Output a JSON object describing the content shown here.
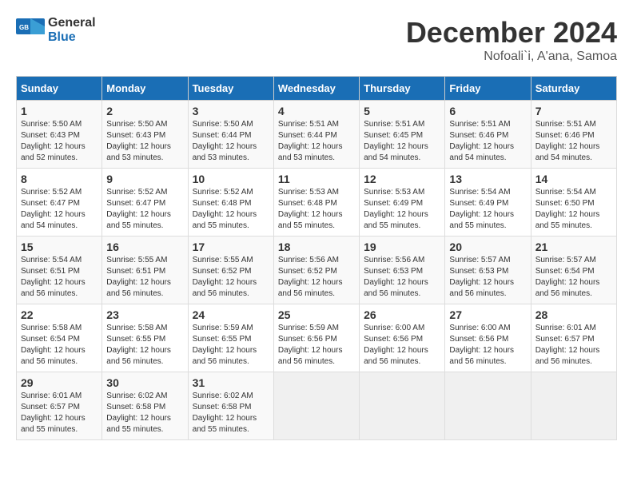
{
  "logo": {
    "general": "General",
    "blue": "Blue"
  },
  "title": "December 2024",
  "location": "Nofoali`i, A'ana, Samoa",
  "days_header": [
    "Sunday",
    "Monday",
    "Tuesday",
    "Wednesday",
    "Thursday",
    "Friday",
    "Saturday"
  ],
  "weeks": [
    [
      {
        "day": "1",
        "info": "Sunrise: 5:50 AM\nSunset: 6:43 PM\nDaylight: 12 hours\nand 52 minutes."
      },
      {
        "day": "2",
        "info": "Sunrise: 5:50 AM\nSunset: 6:43 PM\nDaylight: 12 hours\nand 53 minutes."
      },
      {
        "day": "3",
        "info": "Sunrise: 5:50 AM\nSunset: 6:44 PM\nDaylight: 12 hours\nand 53 minutes."
      },
      {
        "day": "4",
        "info": "Sunrise: 5:51 AM\nSunset: 6:44 PM\nDaylight: 12 hours\nand 53 minutes."
      },
      {
        "day": "5",
        "info": "Sunrise: 5:51 AM\nSunset: 6:45 PM\nDaylight: 12 hours\nand 54 minutes."
      },
      {
        "day": "6",
        "info": "Sunrise: 5:51 AM\nSunset: 6:46 PM\nDaylight: 12 hours\nand 54 minutes."
      },
      {
        "day": "7",
        "info": "Sunrise: 5:51 AM\nSunset: 6:46 PM\nDaylight: 12 hours\nand 54 minutes."
      }
    ],
    [
      {
        "day": "8",
        "info": "Sunrise: 5:52 AM\nSunset: 6:47 PM\nDaylight: 12 hours\nand 54 minutes."
      },
      {
        "day": "9",
        "info": "Sunrise: 5:52 AM\nSunset: 6:47 PM\nDaylight: 12 hours\nand 55 minutes."
      },
      {
        "day": "10",
        "info": "Sunrise: 5:52 AM\nSunset: 6:48 PM\nDaylight: 12 hours\nand 55 minutes."
      },
      {
        "day": "11",
        "info": "Sunrise: 5:53 AM\nSunset: 6:48 PM\nDaylight: 12 hours\nand 55 minutes."
      },
      {
        "day": "12",
        "info": "Sunrise: 5:53 AM\nSunset: 6:49 PM\nDaylight: 12 hours\nand 55 minutes."
      },
      {
        "day": "13",
        "info": "Sunrise: 5:54 AM\nSunset: 6:49 PM\nDaylight: 12 hours\nand 55 minutes."
      },
      {
        "day": "14",
        "info": "Sunrise: 5:54 AM\nSunset: 6:50 PM\nDaylight: 12 hours\nand 55 minutes."
      }
    ],
    [
      {
        "day": "15",
        "info": "Sunrise: 5:54 AM\nSunset: 6:51 PM\nDaylight: 12 hours\nand 56 minutes."
      },
      {
        "day": "16",
        "info": "Sunrise: 5:55 AM\nSunset: 6:51 PM\nDaylight: 12 hours\nand 56 minutes."
      },
      {
        "day": "17",
        "info": "Sunrise: 5:55 AM\nSunset: 6:52 PM\nDaylight: 12 hours\nand 56 minutes."
      },
      {
        "day": "18",
        "info": "Sunrise: 5:56 AM\nSunset: 6:52 PM\nDaylight: 12 hours\nand 56 minutes."
      },
      {
        "day": "19",
        "info": "Sunrise: 5:56 AM\nSunset: 6:53 PM\nDaylight: 12 hours\nand 56 minutes."
      },
      {
        "day": "20",
        "info": "Sunrise: 5:57 AM\nSunset: 6:53 PM\nDaylight: 12 hours\nand 56 minutes."
      },
      {
        "day": "21",
        "info": "Sunrise: 5:57 AM\nSunset: 6:54 PM\nDaylight: 12 hours\nand 56 minutes."
      }
    ],
    [
      {
        "day": "22",
        "info": "Sunrise: 5:58 AM\nSunset: 6:54 PM\nDaylight: 12 hours\nand 56 minutes."
      },
      {
        "day": "23",
        "info": "Sunrise: 5:58 AM\nSunset: 6:55 PM\nDaylight: 12 hours\nand 56 minutes."
      },
      {
        "day": "24",
        "info": "Sunrise: 5:59 AM\nSunset: 6:55 PM\nDaylight: 12 hours\nand 56 minutes."
      },
      {
        "day": "25",
        "info": "Sunrise: 5:59 AM\nSunset: 6:56 PM\nDaylight: 12 hours\nand 56 minutes."
      },
      {
        "day": "26",
        "info": "Sunrise: 6:00 AM\nSunset: 6:56 PM\nDaylight: 12 hours\nand 56 minutes."
      },
      {
        "day": "27",
        "info": "Sunrise: 6:00 AM\nSunset: 6:56 PM\nDaylight: 12 hours\nand 56 minutes."
      },
      {
        "day": "28",
        "info": "Sunrise: 6:01 AM\nSunset: 6:57 PM\nDaylight: 12 hours\nand 56 minutes."
      }
    ],
    [
      {
        "day": "29",
        "info": "Sunrise: 6:01 AM\nSunset: 6:57 PM\nDaylight: 12 hours\nand 55 minutes."
      },
      {
        "day": "30",
        "info": "Sunrise: 6:02 AM\nSunset: 6:58 PM\nDaylight: 12 hours\nand 55 minutes."
      },
      {
        "day": "31",
        "info": "Sunrise: 6:02 AM\nSunset: 6:58 PM\nDaylight: 12 hours\nand 55 minutes."
      },
      null,
      null,
      null,
      null
    ]
  ]
}
